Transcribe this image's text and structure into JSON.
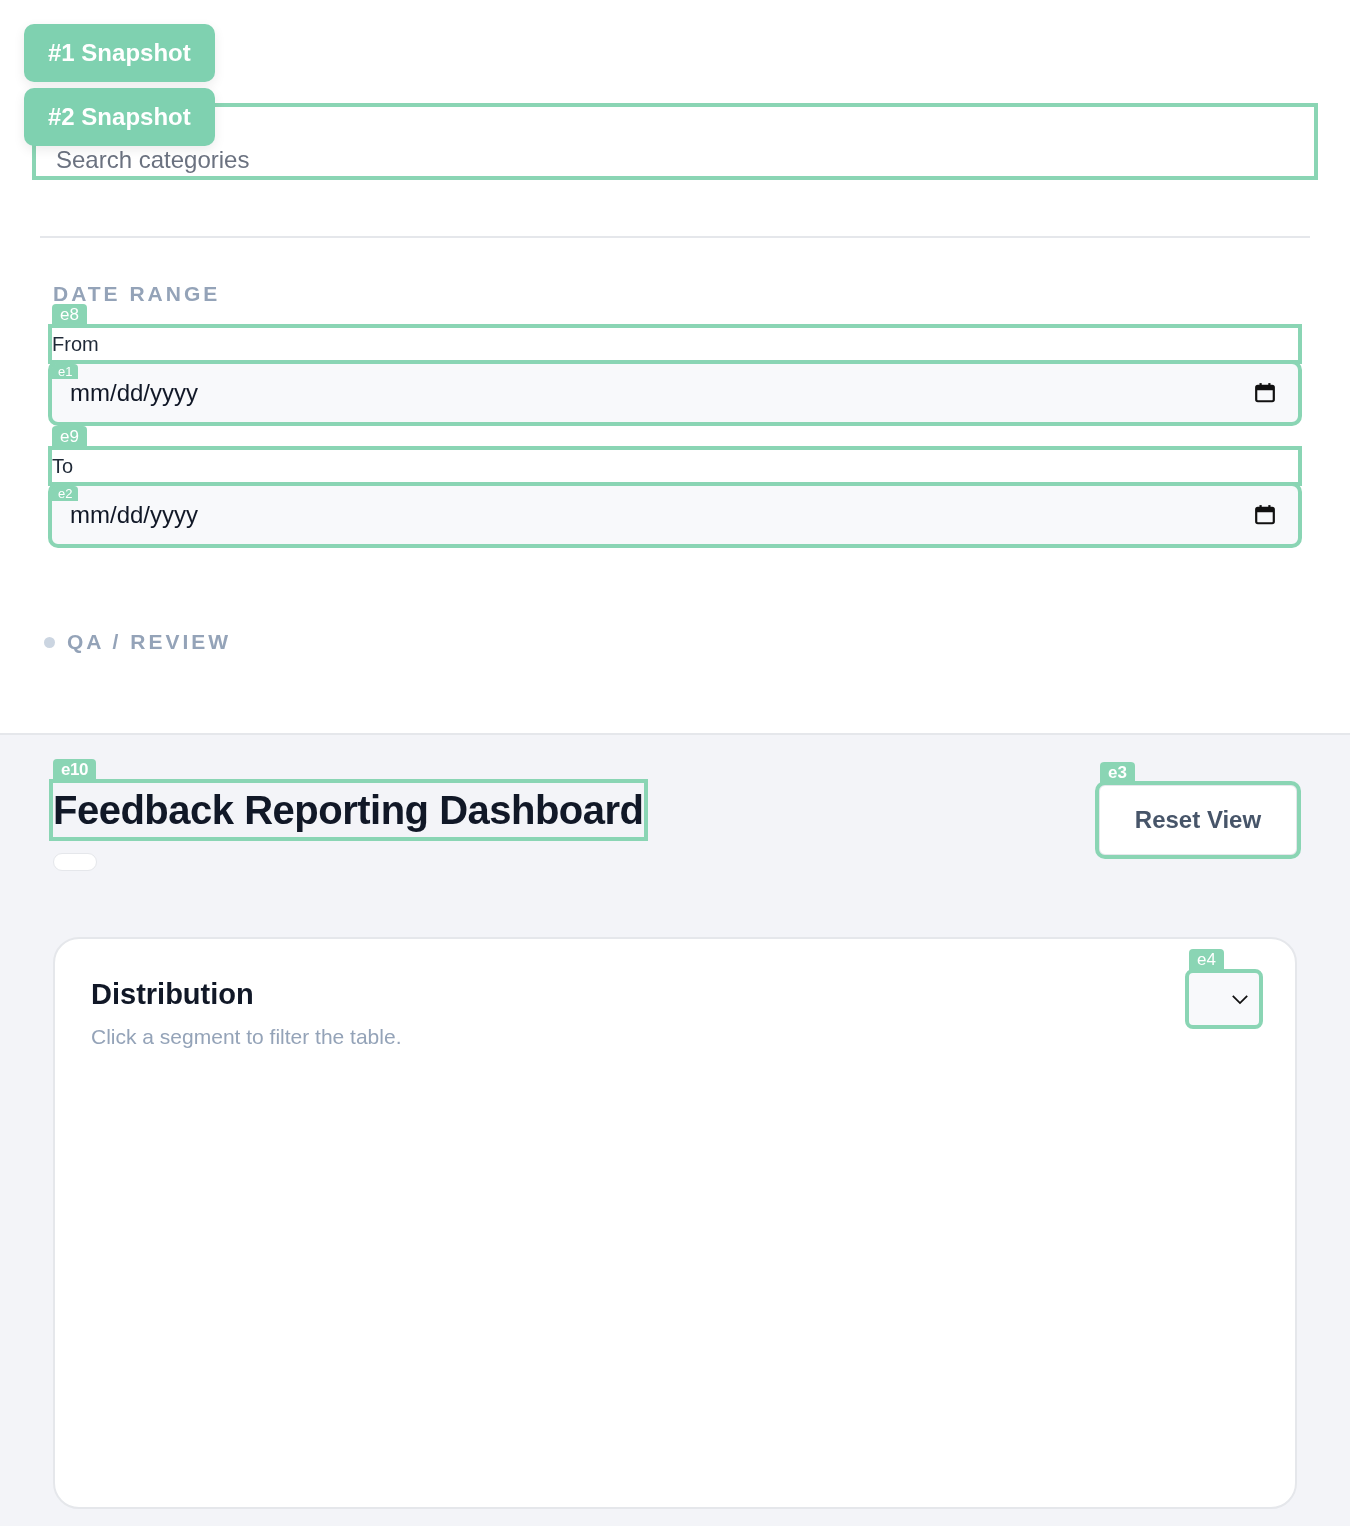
{
  "snapshots": [
    {
      "label": "#1 Snapshot"
    },
    {
      "label": "#2 Snapshot"
    }
  ],
  "search": {
    "placeholder": "Search categories",
    "outlined": true
  },
  "date_range": {
    "heading": "DATE RANGE",
    "fields": [
      {
        "label": "From",
        "label_tag": "e8",
        "placeholder": "mm/dd/yyyy",
        "tag": "e1",
        "outlined": true
      },
      {
        "label": "To",
        "label_tag": "e9",
        "placeholder": "mm/dd/yyyy",
        "tag": "e2",
        "outlined": true
      }
    ]
  },
  "section": {
    "label": "QA / REVIEW"
  },
  "header": {
    "title": "Feedback Reporting Dashboard",
    "title_tag": "e10",
    "button": "Reset View",
    "button_tag": "e3"
  },
  "card": {
    "title": "Distribution",
    "subtitle": "Click a segment to filter the table.",
    "select_tag": "e4"
  }
}
